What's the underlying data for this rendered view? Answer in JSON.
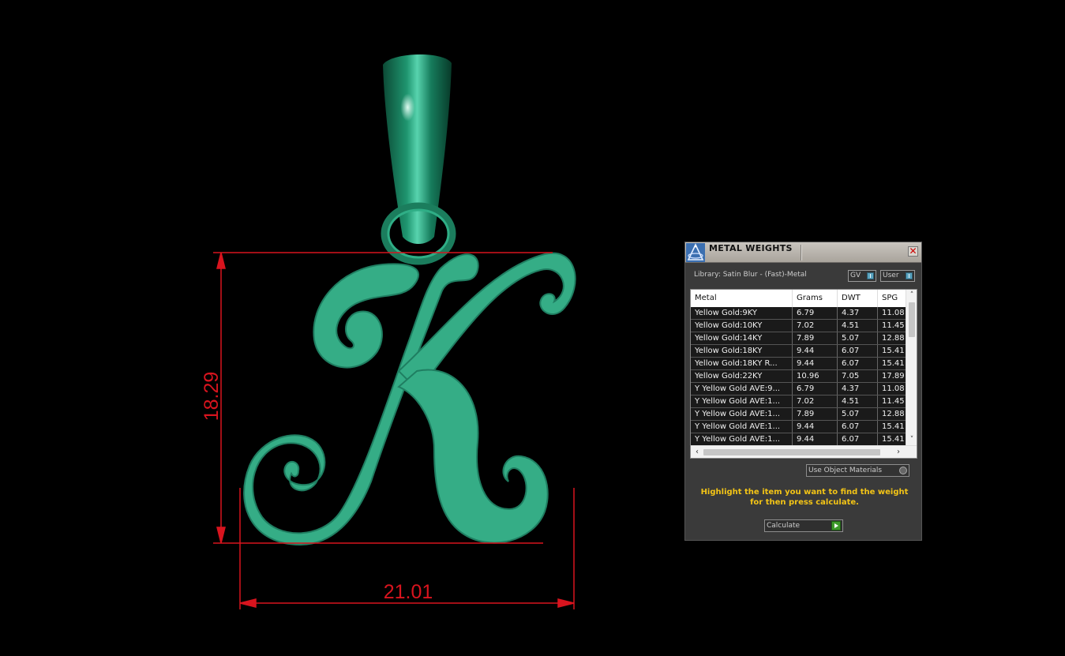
{
  "viewport": {
    "model": "letter-k-pendant",
    "colors": {
      "background": "#000000",
      "pendant": "#35ad86",
      "dimension": "#d8141e"
    },
    "dimensions": {
      "height_label": "18.29",
      "width_label": "21.01"
    }
  },
  "panel": {
    "title": "METAL WEIGHTS",
    "close_symbol": "✕",
    "library_label": "Library: Satin Blur - (Fast)-Metal",
    "toggle_gv": "GV",
    "toggle_user": "User",
    "columns": [
      "Metal",
      "Grams",
      "DWT",
      "SPG"
    ],
    "rows": [
      [
        "Yellow Gold:9KY",
        "6.79",
        "4.37",
        "11.08"
      ],
      [
        "Yellow Gold:10KY",
        "7.02",
        "4.51",
        "11.45"
      ],
      [
        "Yellow Gold:14KY",
        "7.89",
        "5.07",
        "12.88"
      ],
      [
        "Yellow Gold:18KY",
        "9.44",
        "6.07",
        "15.41"
      ],
      [
        "Yellow Gold:18KY R...",
        "9.44",
        "6.07",
        "15.41"
      ],
      [
        "Yellow Gold:22KY",
        "10.96",
        "7.05",
        "17.89"
      ],
      [
        "Y Yellow Gold AVE:9...",
        "6.79",
        "4.37",
        "11.08"
      ],
      [
        "Y Yellow Gold AVE:1...",
        "7.02",
        "4.51",
        "11.45"
      ],
      [
        "Y Yellow Gold AVE:1...",
        "7.89",
        "5.07",
        "12.88"
      ],
      [
        "Y Yellow Gold AVE:1...",
        "9.44",
        "6.07",
        "15.41"
      ],
      [
        "Y Yellow Gold AVE:1...",
        "9.44",
        "6.07",
        "15.41"
      ]
    ],
    "scroll_up": "˄",
    "scroll_down": "˅",
    "scroll_left": "‹",
    "scroll_right": "›",
    "use_object_materials": "Use Object Materials",
    "hint": "Highlight the item you want to find the weight for then press calculate.",
    "calculate": "Calculate",
    "accent": "#f3c416"
  }
}
